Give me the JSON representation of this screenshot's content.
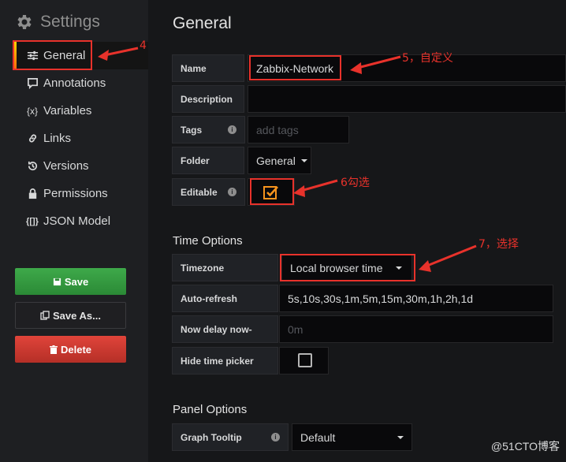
{
  "sidebar": {
    "title": "Settings",
    "items": [
      {
        "label": "General",
        "icon": "sliders-icon"
      },
      {
        "label": "Annotations",
        "icon": "comment-icon"
      },
      {
        "label": "Variables",
        "icon": "variables-icon"
      },
      {
        "label": "Links",
        "icon": "link-icon"
      },
      {
        "label": "Versions",
        "icon": "history-icon"
      },
      {
        "label": "Permissions",
        "icon": "lock-icon"
      },
      {
        "label": "JSON Model",
        "icon": "json-icon"
      }
    ],
    "buttons": {
      "save": "Save",
      "save_as": "Save As...",
      "delete": "Delete"
    }
  },
  "general": {
    "heading": "General",
    "name_label": "Name",
    "name_value": "Zabbix-Network",
    "description_label": "Description",
    "description_value": "",
    "tags_label": "Tags",
    "tags_placeholder": "add tags",
    "folder_label": "Folder",
    "folder_value": "General",
    "editable_label": "Editable",
    "editable_checked": true
  },
  "time_options": {
    "heading": "Time Options",
    "timezone_label": "Timezone",
    "timezone_value": "Local browser time",
    "autorefresh_label": "Auto-refresh",
    "autorefresh_value": "5s,10s,30s,1m,5m,15m,30m,1h,2h,1d",
    "nowdelay_label": "Now delay now-",
    "nowdelay_placeholder": "0m",
    "hidepicker_label": "Hide time picker",
    "hidepicker_checked": false
  },
  "panel_options": {
    "heading": "Panel Options",
    "tooltip_label": "Graph Tooltip",
    "tooltip_value": "Default"
  },
  "annotations": {
    "a4": "4",
    "a5": "5，自定义",
    "a6": "6勾选",
    "a7": "7，选择"
  },
  "watermark": "@51CTO博客",
  "colors": {
    "accent_red": "#e8322b",
    "save_green": "#2b8a36",
    "delete_red": "#c9372c",
    "checkbox_orange": "#f7941d"
  }
}
